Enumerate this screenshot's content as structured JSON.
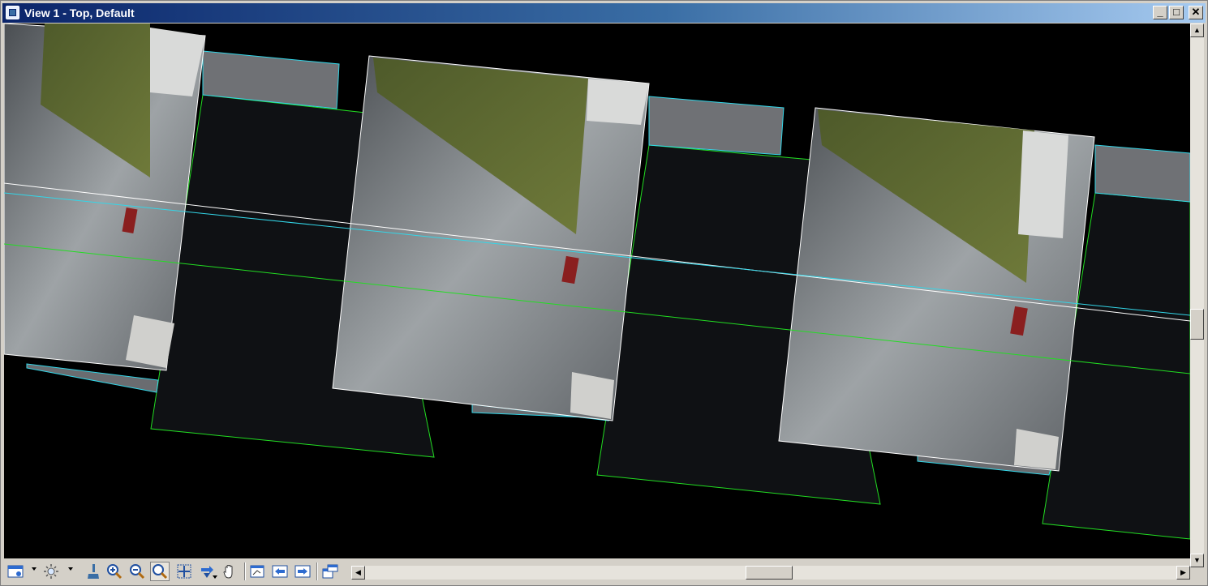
{
  "window": {
    "title": "View 1 - Top, Default",
    "controls": {
      "minimize": "_",
      "maximize": "□",
      "close": "✕"
    }
  },
  "viewport": {
    "background": "#000000",
    "frame_colors": {
      "outline_a": "#ffffff",
      "outline_b": "#33d6e8",
      "outline_c": "#22dd22"
    },
    "content": "aerial-street-image-tiles"
  },
  "toolbar": {
    "tools": [
      {
        "name": "view-attributes",
        "icon": "view-attributes-icon",
        "has_dropdown": true
      },
      {
        "name": "display-style",
        "icon": "sun-icon",
        "has_dropdown": true
      },
      {
        "name": "update-view",
        "icon": "brush-icon"
      },
      {
        "name": "zoom-in",
        "icon": "zoom-in-icon"
      },
      {
        "name": "zoom-out",
        "icon": "zoom-out-icon"
      },
      {
        "name": "window-area",
        "icon": "window-area-icon",
        "active": true
      },
      {
        "name": "fit-view",
        "icon": "fit-view-icon"
      },
      {
        "name": "rotate-view",
        "icon": "rotate-view-icon",
        "has_dropdown": true
      },
      {
        "name": "pan-view",
        "icon": "hand-icon"
      },
      {
        "name": "view-previous",
        "icon": "view-previous-icon"
      },
      {
        "name": "previous",
        "icon": "arrow-left-icon"
      },
      {
        "name": "next",
        "icon": "arrow-right-icon"
      },
      {
        "name": "copy-view",
        "icon": "copy-view-icon"
      }
    ]
  },
  "scrollbars": {
    "vertical": {
      "position": 0.53
    },
    "horizontal": {
      "position": 0.5
    }
  }
}
